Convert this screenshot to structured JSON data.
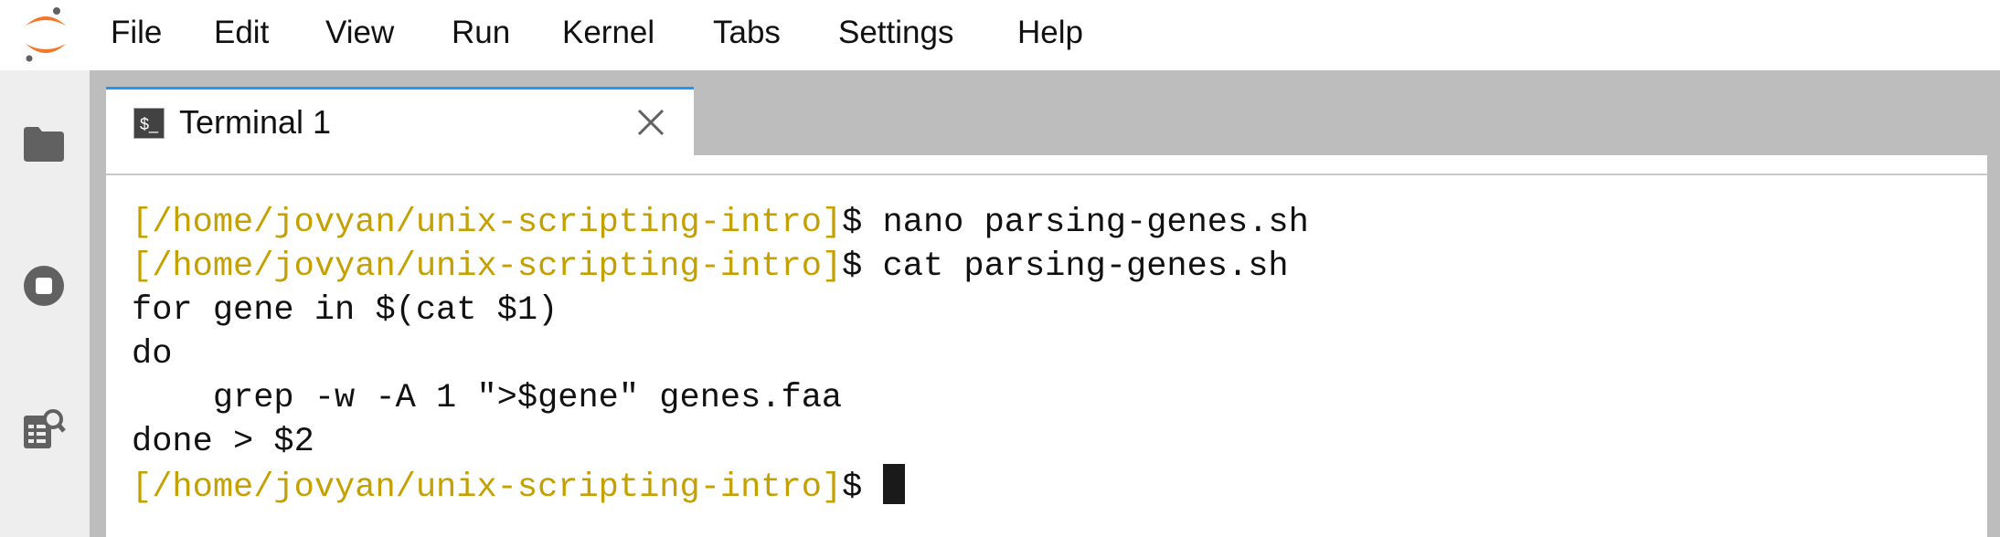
{
  "menubar": {
    "items": [
      "File",
      "Edit",
      "View",
      "Run",
      "Kernel",
      "Tabs",
      "Settings",
      "Help"
    ]
  },
  "sidebar": {
    "icons": [
      "folder-icon",
      "stop-circle-icon",
      "property-inspector-icon"
    ]
  },
  "tab": {
    "icon_text": "$_",
    "label": "Terminal 1"
  },
  "terminal": {
    "prompt_color": "#c4a000",
    "lines": [
      {
        "prompt": "[/home/jovyan/unix-scripting-intro]",
        "text": "$ nano parsing-genes.sh"
      },
      {
        "prompt": "[/home/jovyan/unix-scripting-intro]",
        "text": "$ cat parsing-genes.sh"
      },
      {
        "prompt": "",
        "text": "for gene in $(cat $1)"
      },
      {
        "prompt": "",
        "text": "do"
      },
      {
        "prompt": "",
        "text": "    grep -w -A 1 \">$gene\" genes.faa"
      },
      {
        "prompt": "",
        "text": "done > $2"
      },
      {
        "prompt": "[/home/jovyan/unix-scripting-intro]",
        "text": "$ "
      }
    ]
  }
}
